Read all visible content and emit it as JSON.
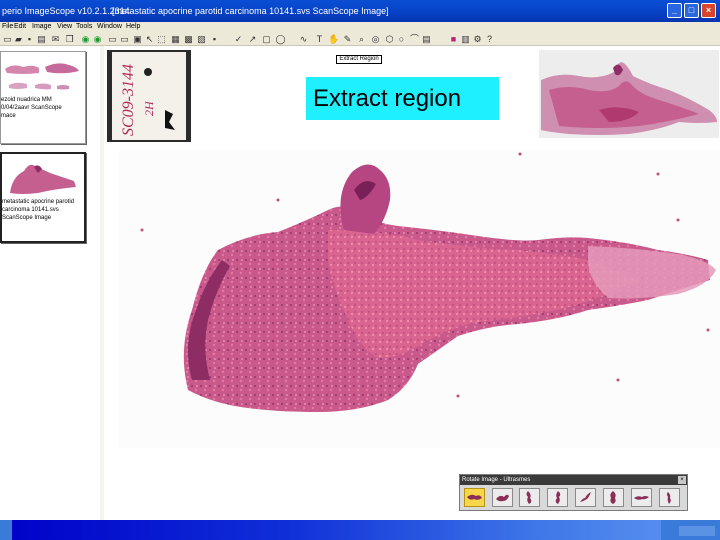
{
  "window": {
    "app_title": "perio ImageScope v10.2.1.2314",
    "document_title": "[metastatic apocrine parotid carcinoma 10141.svs  ScanScope Image]",
    "buttons": [
      "_",
      "□",
      "×"
    ]
  },
  "menu": [
    "File",
    "Edit",
    "Image",
    "View",
    "Tools",
    "Window",
    "Help"
  ],
  "toolbar_icons": [
    "open-icon",
    "folder-icon",
    "save-icon",
    "print-icon",
    "mail-icon",
    "copy-icon",
    "paste-icon",
    "back-arrow-icon",
    "forward-arrow-icon",
    "zoom-in-icon",
    "zoom-out-icon",
    "fit-icon",
    "pan-icon",
    "select-icon",
    "extract-icon",
    "layers-icon",
    "annotation-icon",
    "pen-icon",
    "ruler-icon",
    "arrow-icon",
    "rectangle-icon",
    "ellipse-icon",
    "freehand-icon",
    "text-icon",
    "hand-icon",
    "color-icon",
    "histogram-icon",
    "help-icon"
  ],
  "sidebar": {
    "thumbnails": [
      {
        "lines": [
          "ezoid nuadrica MM",
          "0/04/2aavr ScanScope",
          "mace"
        ],
        "selected": false
      },
      {
        "lines": [
          "metastatic apocrine parotid",
          "carcinoma 10141.svs",
          "ScanScope Image"
        ],
        "selected": true
      }
    ]
  },
  "viewer": {
    "extract_button_label": "Extract Region",
    "callout_text": "Extract region",
    "label_handwriting": [
      "SC09-3144",
      "2H"
    ]
  },
  "rotate_panel": {
    "title": "Rotate Image - Ultrasmes",
    "close_label": "×",
    "selected_index": 0,
    "button_count": 8
  },
  "colors": {
    "titlebar": "#0743c7",
    "callout": "#1ff0ff",
    "tissue": "#c24f7e",
    "tissue_dark": "#8e2d64",
    "chrome": "#ece9d8",
    "taskbar": "#0f2fd8"
  }
}
